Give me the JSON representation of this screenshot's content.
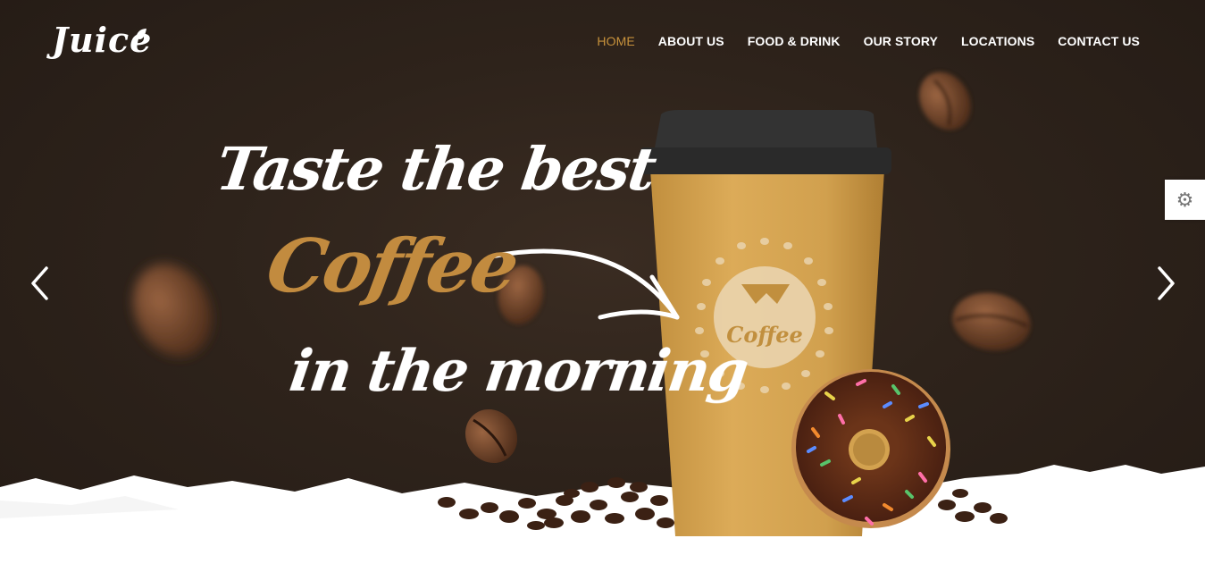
{
  "brand": {
    "name": "Juice"
  },
  "nav": {
    "items": [
      {
        "label": "HOME",
        "active": true
      },
      {
        "label": "ABOUT US",
        "active": false
      },
      {
        "label": "FOOD & DRINK",
        "active": false
      },
      {
        "label": "OUR STORY",
        "active": false
      },
      {
        "label": "LOCATIONS",
        "active": false
      },
      {
        "label": "CONTACT US",
        "active": false
      }
    ]
  },
  "hero": {
    "line1": "Taste the best",
    "line2": "Coffee",
    "line3": "in the morning",
    "cup_label": "Coffee"
  },
  "icons": {
    "prev": "chevron-left-icon",
    "next": "chevron-right-icon",
    "settings": "gear-icon"
  },
  "colors": {
    "accent": "#c8923c",
    "background": "#2e231b",
    "cup": "#d3a24f",
    "lid": "#2b2b2b",
    "white": "#ffffff"
  }
}
